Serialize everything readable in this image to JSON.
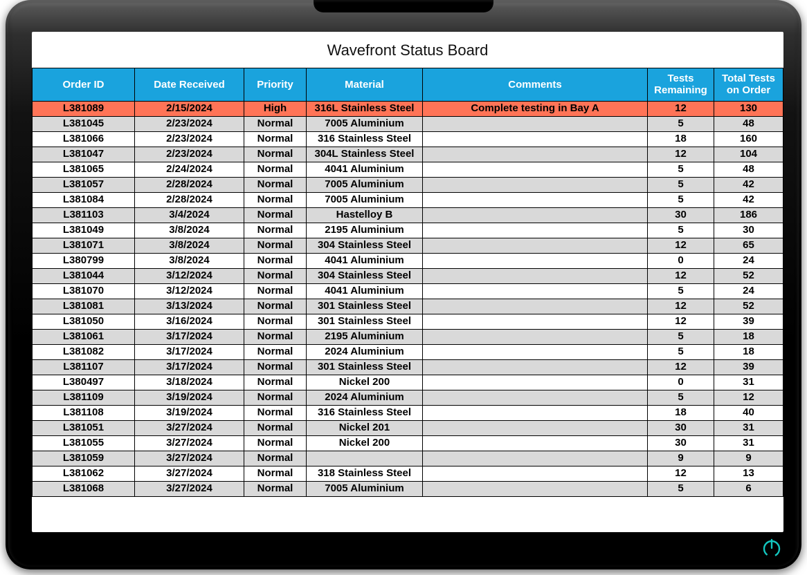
{
  "title": "Wavefront Status Board",
  "columns": [
    "Order ID",
    "Date Received",
    "Priority",
    "Material",
    "Comments",
    "Tests Remaining",
    "Total Tests on Order"
  ],
  "rows": [
    {
      "order_id": "L381089",
      "date": "2/15/2024",
      "priority": "High",
      "material": "316L Stainless Steel",
      "comments": "Complete testing in Bay A",
      "remaining": "12",
      "total": "130",
      "severity": "high"
    },
    {
      "order_id": "L381045",
      "date": "2/23/2024",
      "priority": "Normal",
      "material": "7005 Aluminium",
      "comments": "",
      "remaining": "5",
      "total": "48"
    },
    {
      "order_id": "L381066",
      "date": "2/23/2024",
      "priority": "Normal",
      "material": "316 Stainless Steel",
      "comments": "",
      "remaining": "18",
      "total": "160"
    },
    {
      "order_id": "L381047",
      "date": "2/23/2024",
      "priority": "Normal",
      "material": "304L Stainless Steel",
      "comments": "",
      "remaining": "12",
      "total": "104"
    },
    {
      "order_id": "L381065",
      "date": "2/24/2024",
      "priority": "Normal",
      "material": "4041 Aluminium",
      "comments": "",
      "remaining": "5",
      "total": "48"
    },
    {
      "order_id": "L381057",
      "date": "2/28/2024",
      "priority": "Normal",
      "material": "7005 Aluminium",
      "comments": "",
      "remaining": "5",
      "total": "42"
    },
    {
      "order_id": "L381084",
      "date": "2/28/2024",
      "priority": "Normal",
      "material": "7005 Aluminium",
      "comments": "",
      "remaining": "5",
      "total": "42"
    },
    {
      "order_id": "L381103",
      "date": "3/4/2024",
      "priority": "Normal",
      "material": "Hastelloy B",
      "comments": "",
      "remaining": "30",
      "total": "186"
    },
    {
      "order_id": "L381049",
      "date": "3/8/2024",
      "priority": "Normal",
      "material": "2195 Aluminium",
      "comments": "",
      "remaining": "5",
      "total": "30"
    },
    {
      "order_id": "L381071",
      "date": "3/8/2024",
      "priority": "Normal",
      "material": "304 Stainless Steel",
      "comments": "",
      "remaining": "12",
      "total": "65"
    },
    {
      "order_id": "L380799",
      "date": "3/8/2024",
      "priority": "Normal",
      "material": "4041 Aluminium",
      "comments": "",
      "remaining": "0",
      "total": "24"
    },
    {
      "order_id": "L381044",
      "date": "3/12/2024",
      "priority": "Normal",
      "material": "304 Stainless Steel",
      "comments": "",
      "remaining": "12",
      "total": "52"
    },
    {
      "order_id": "L381070",
      "date": "3/12/2024",
      "priority": "Normal",
      "material": "4041 Aluminium",
      "comments": "",
      "remaining": "5",
      "total": "24"
    },
    {
      "order_id": "L381081",
      "date": "3/13/2024",
      "priority": "Normal",
      "material": "301 Stainless Steel",
      "comments": "",
      "remaining": "12",
      "total": "52"
    },
    {
      "order_id": "L381050",
      "date": "3/16/2024",
      "priority": "Normal",
      "material": "301 Stainless Steel",
      "comments": "",
      "remaining": "12",
      "total": "39"
    },
    {
      "order_id": "L381061",
      "date": "3/17/2024",
      "priority": "Normal",
      "material": "2195 Aluminium",
      "comments": "",
      "remaining": "5",
      "total": "18"
    },
    {
      "order_id": "L381082",
      "date": "3/17/2024",
      "priority": "Normal",
      "material": "2024 Aluminium",
      "comments": "",
      "remaining": "5",
      "total": "18"
    },
    {
      "order_id": "L381107",
      "date": "3/17/2024",
      "priority": "Normal",
      "material": "301 Stainless Steel",
      "comments": "",
      "remaining": "12",
      "total": "39"
    },
    {
      "order_id": "L380497",
      "date": "3/18/2024",
      "priority": "Normal",
      "material": "Nickel 200",
      "comments": "",
      "remaining": "0",
      "total": "31"
    },
    {
      "order_id": "L381109",
      "date": "3/19/2024",
      "priority": "Normal",
      "material": "2024 Aluminium",
      "comments": "",
      "remaining": "5",
      "total": "12"
    },
    {
      "order_id": "L381108",
      "date": "3/19/2024",
      "priority": "Normal",
      "material": "316 Stainless Steel",
      "comments": "",
      "remaining": "18",
      "total": "40"
    },
    {
      "order_id": "L381051",
      "date": "3/27/2024",
      "priority": "Normal",
      "material": "Nickel 201",
      "comments": "",
      "remaining": "30",
      "total": "31"
    },
    {
      "order_id": "L381055",
      "date": "3/27/2024",
      "priority": "Normal",
      "material": "Nickel 200",
      "comments": "",
      "remaining": "30",
      "total": "31"
    },
    {
      "order_id": "L381059",
      "date": "3/27/2024",
      "priority": "Normal",
      "material": "",
      "comments": "",
      "remaining": "9",
      "total": "9"
    },
    {
      "order_id": "L381062",
      "date": "3/27/2024",
      "priority": "Normal",
      "material": "318 Stainless Steel",
      "comments": "",
      "remaining": "12",
      "total": "13"
    },
    {
      "order_id": "L381068",
      "date": "3/27/2024",
      "priority": "Normal",
      "material": "7005 Aluminium",
      "comments": "",
      "remaining": "5",
      "total": "6"
    }
  ],
  "colors": {
    "header_bg": "#1aa3dd",
    "high_row": "#ff7457",
    "alt_row": "#d9d9d9"
  }
}
